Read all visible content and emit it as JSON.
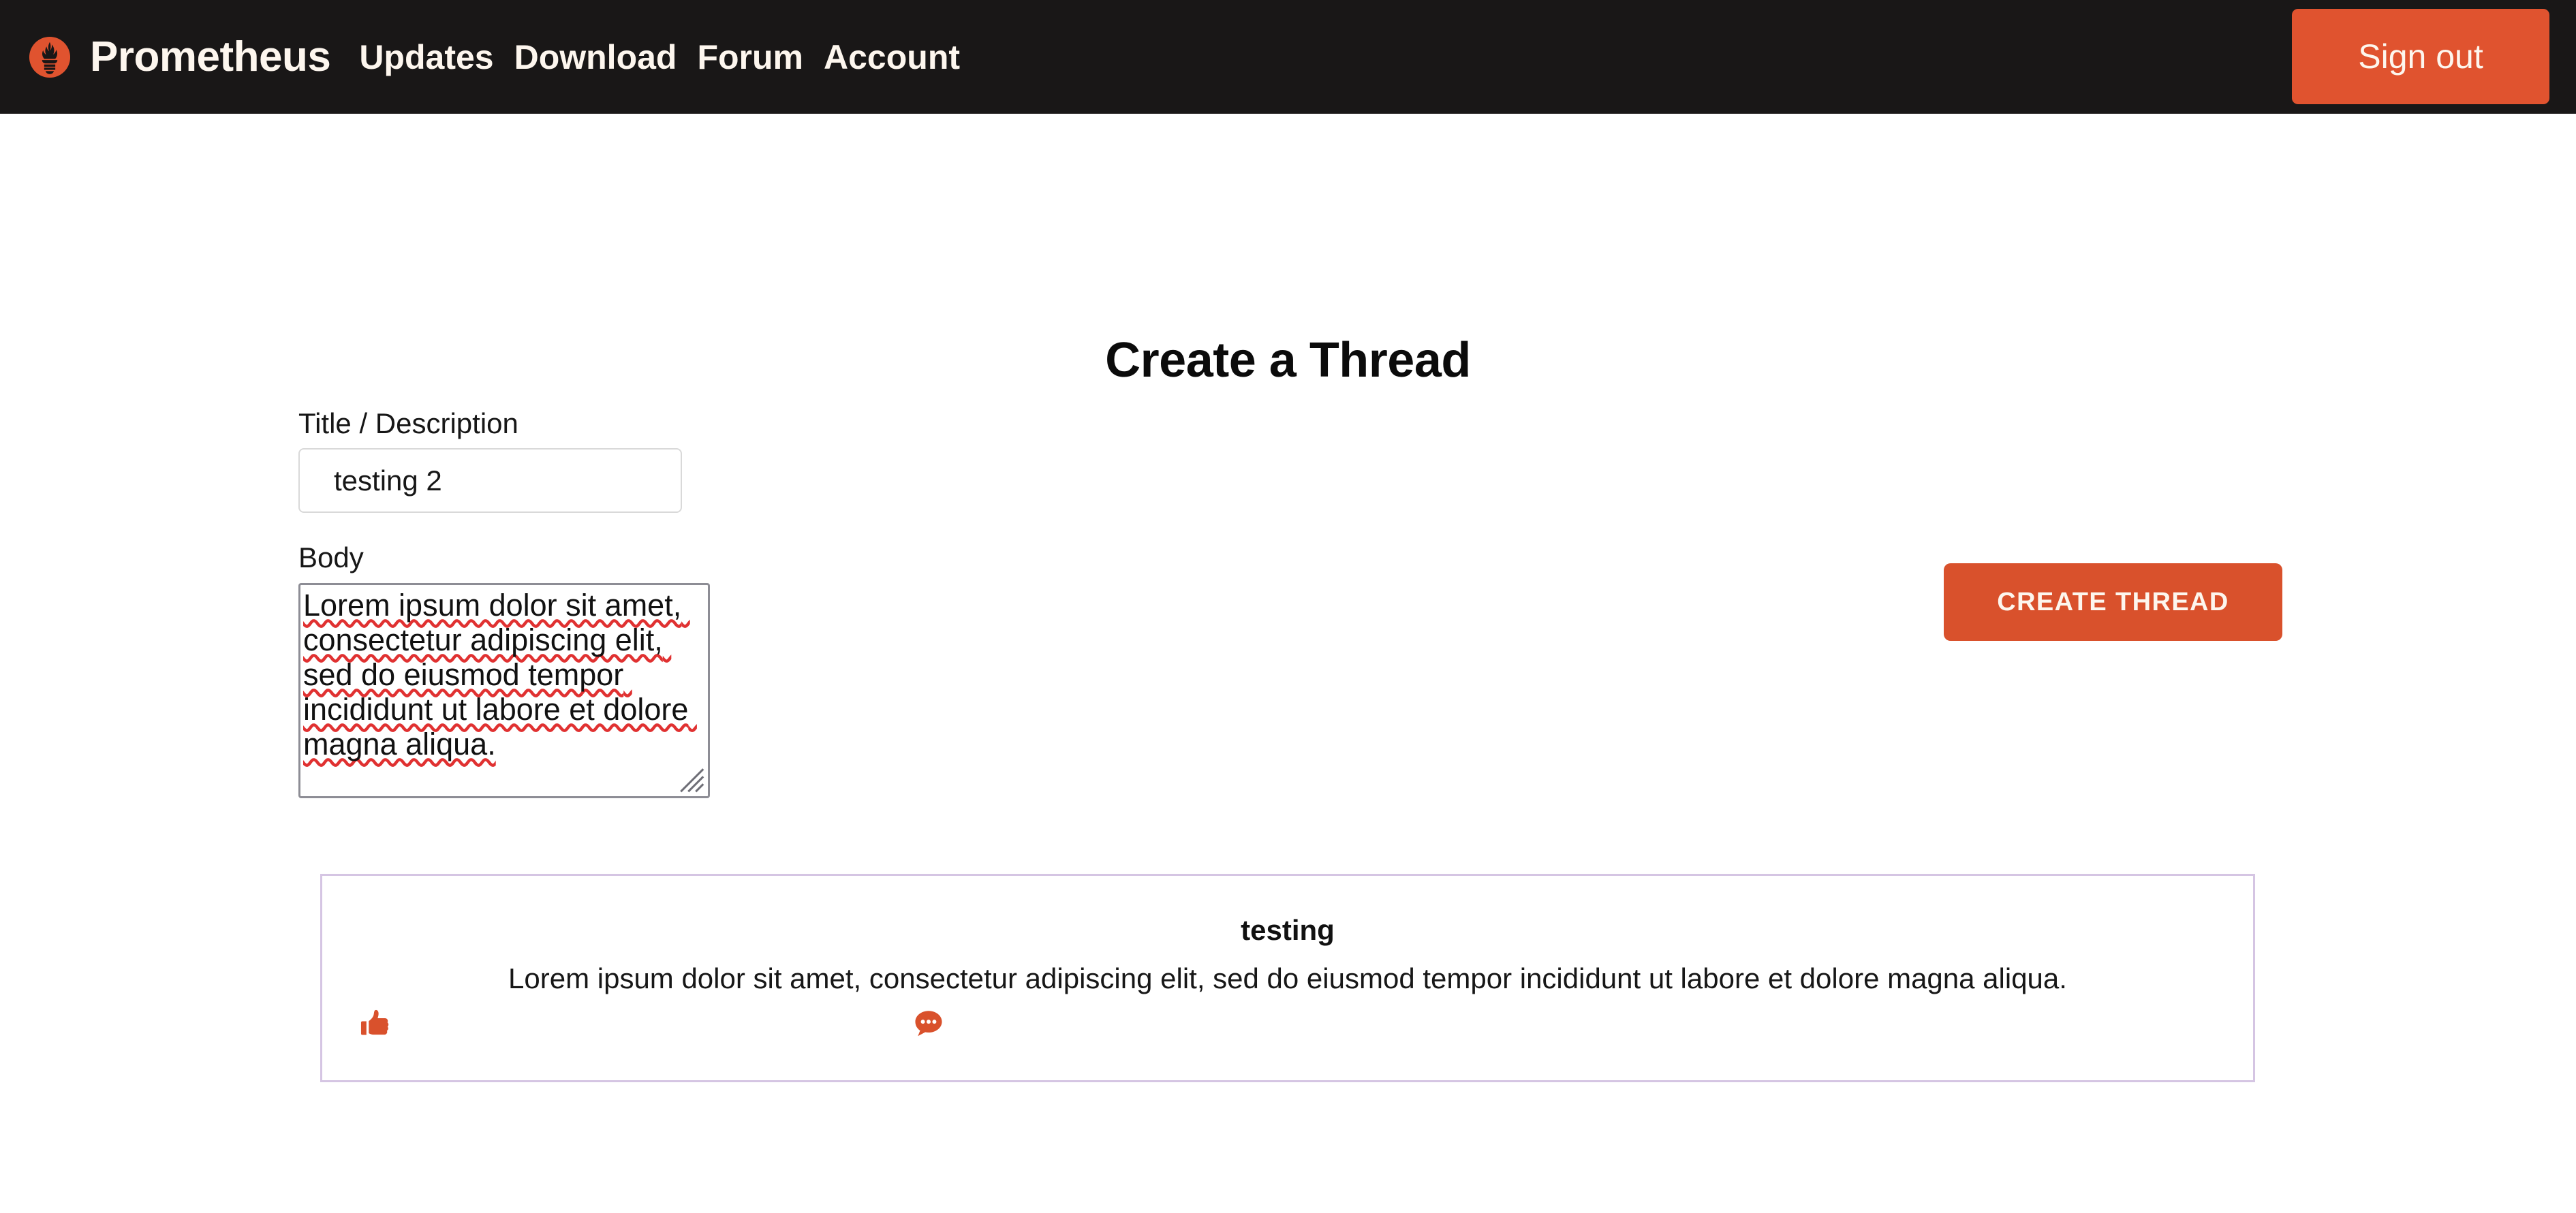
{
  "header": {
    "logo_icon": "prometheus-flame-logo",
    "brand": "Prometheus",
    "nav": [
      {
        "label": "Updates"
      },
      {
        "label": "Download"
      },
      {
        "label": "Forum"
      },
      {
        "label": "Account"
      }
    ],
    "signout_label": "Sign out"
  },
  "main": {
    "page_title": "Create a Thread",
    "form": {
      "title_label": "Title / Description",
      "title_value": "testing 2",
      "title_placeholder": "",
      "body_label": "Body",
      "body_value": "Lorem ipsum dolor sit amet, consectetur adipiscing elit, sed do eiusmod tempor incididunt ut labore et dolore magna aliqua.",
      "body_placeholder": "",
      "submit_label": "CREATE THREAD"
    },
    "threads": [
      {
        "title": "testing",
        "body": "Lorem ipsum dolor sit amet, consectetur adipiscing elit, sed do eiusmod tempor incididunt ut labore et dolore magna aliqua.",
        "like_icon": "thumbs-up-icon",
        "comment_icon": "comment-bubble-icon"
      }
    ]
  },
  "colors": {
    "header_background": "#191717",
    "accent_orange": "#e0532f",
    "button_orange": "#d9512c",
    "card_border_purple": "#d5c5e3",
    "text_light": "#fdf6ee",
    "input_border": "#d9d9d9",
    "textarea_border": "#8d8d95",
    "spellcheck_red": "#e03131"
  }
}
